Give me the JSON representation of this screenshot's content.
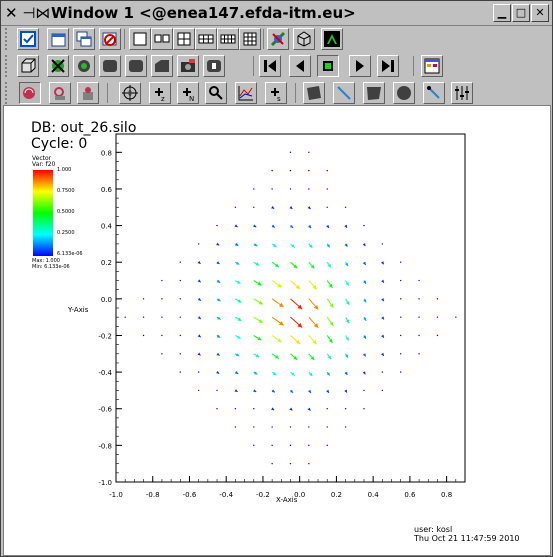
{
  "window": {
    "title": "Window 1 <@enea147.efda-itm.eu>",
    "title_icons": [
      "x-window-icon",
      "pin-icon"
    ],
    "controls": [
      "minimize",
      "maximize",
      "close"
    ]
  },
  "plot": {
    "db_label": "DB: out_26.silo",
    "cycle_label": "Cycle: 0",
    "legend": {
      "title": "Vector",
      "var": "Var: f20",
      "ticks": [
        "1.000",
        "0.7500",
        "0.5000",
        "0.2500",
        "6.133e-06"
      ],
      "max_label": "Max:  1.000",
      "min_label": "Min:  6.133e-06"
    },
    "ylabel": "Y-Axis",
    "xlabel": "X-Axis",
    "yticks": [
      "0.8",
      "0.6",
      "0.4",
      "0.2",
      "0.0",
      "-0.2",
      "-0.4",
      "-0.6",
      "-0.8",
      "-1.0"
    ],
    "xticks": [
      "-1.0",
      "-0.8",
      "-0.6",
      "-0.4",
      "-0.2",
      "0.0",
      "0.2",
      "0.4",
      "0.6",
      "0.8"
    ],
    "user_label": "user: kosl",
    "date_label": "Thu Oct 21 11:47:59 2010"
  },
  "colors": {
    "title_bg": "#c0c0c0",
    "toolbar_bg": "#c0c0c0",
    "canvas_bg": "#ffffff"
  }
}
